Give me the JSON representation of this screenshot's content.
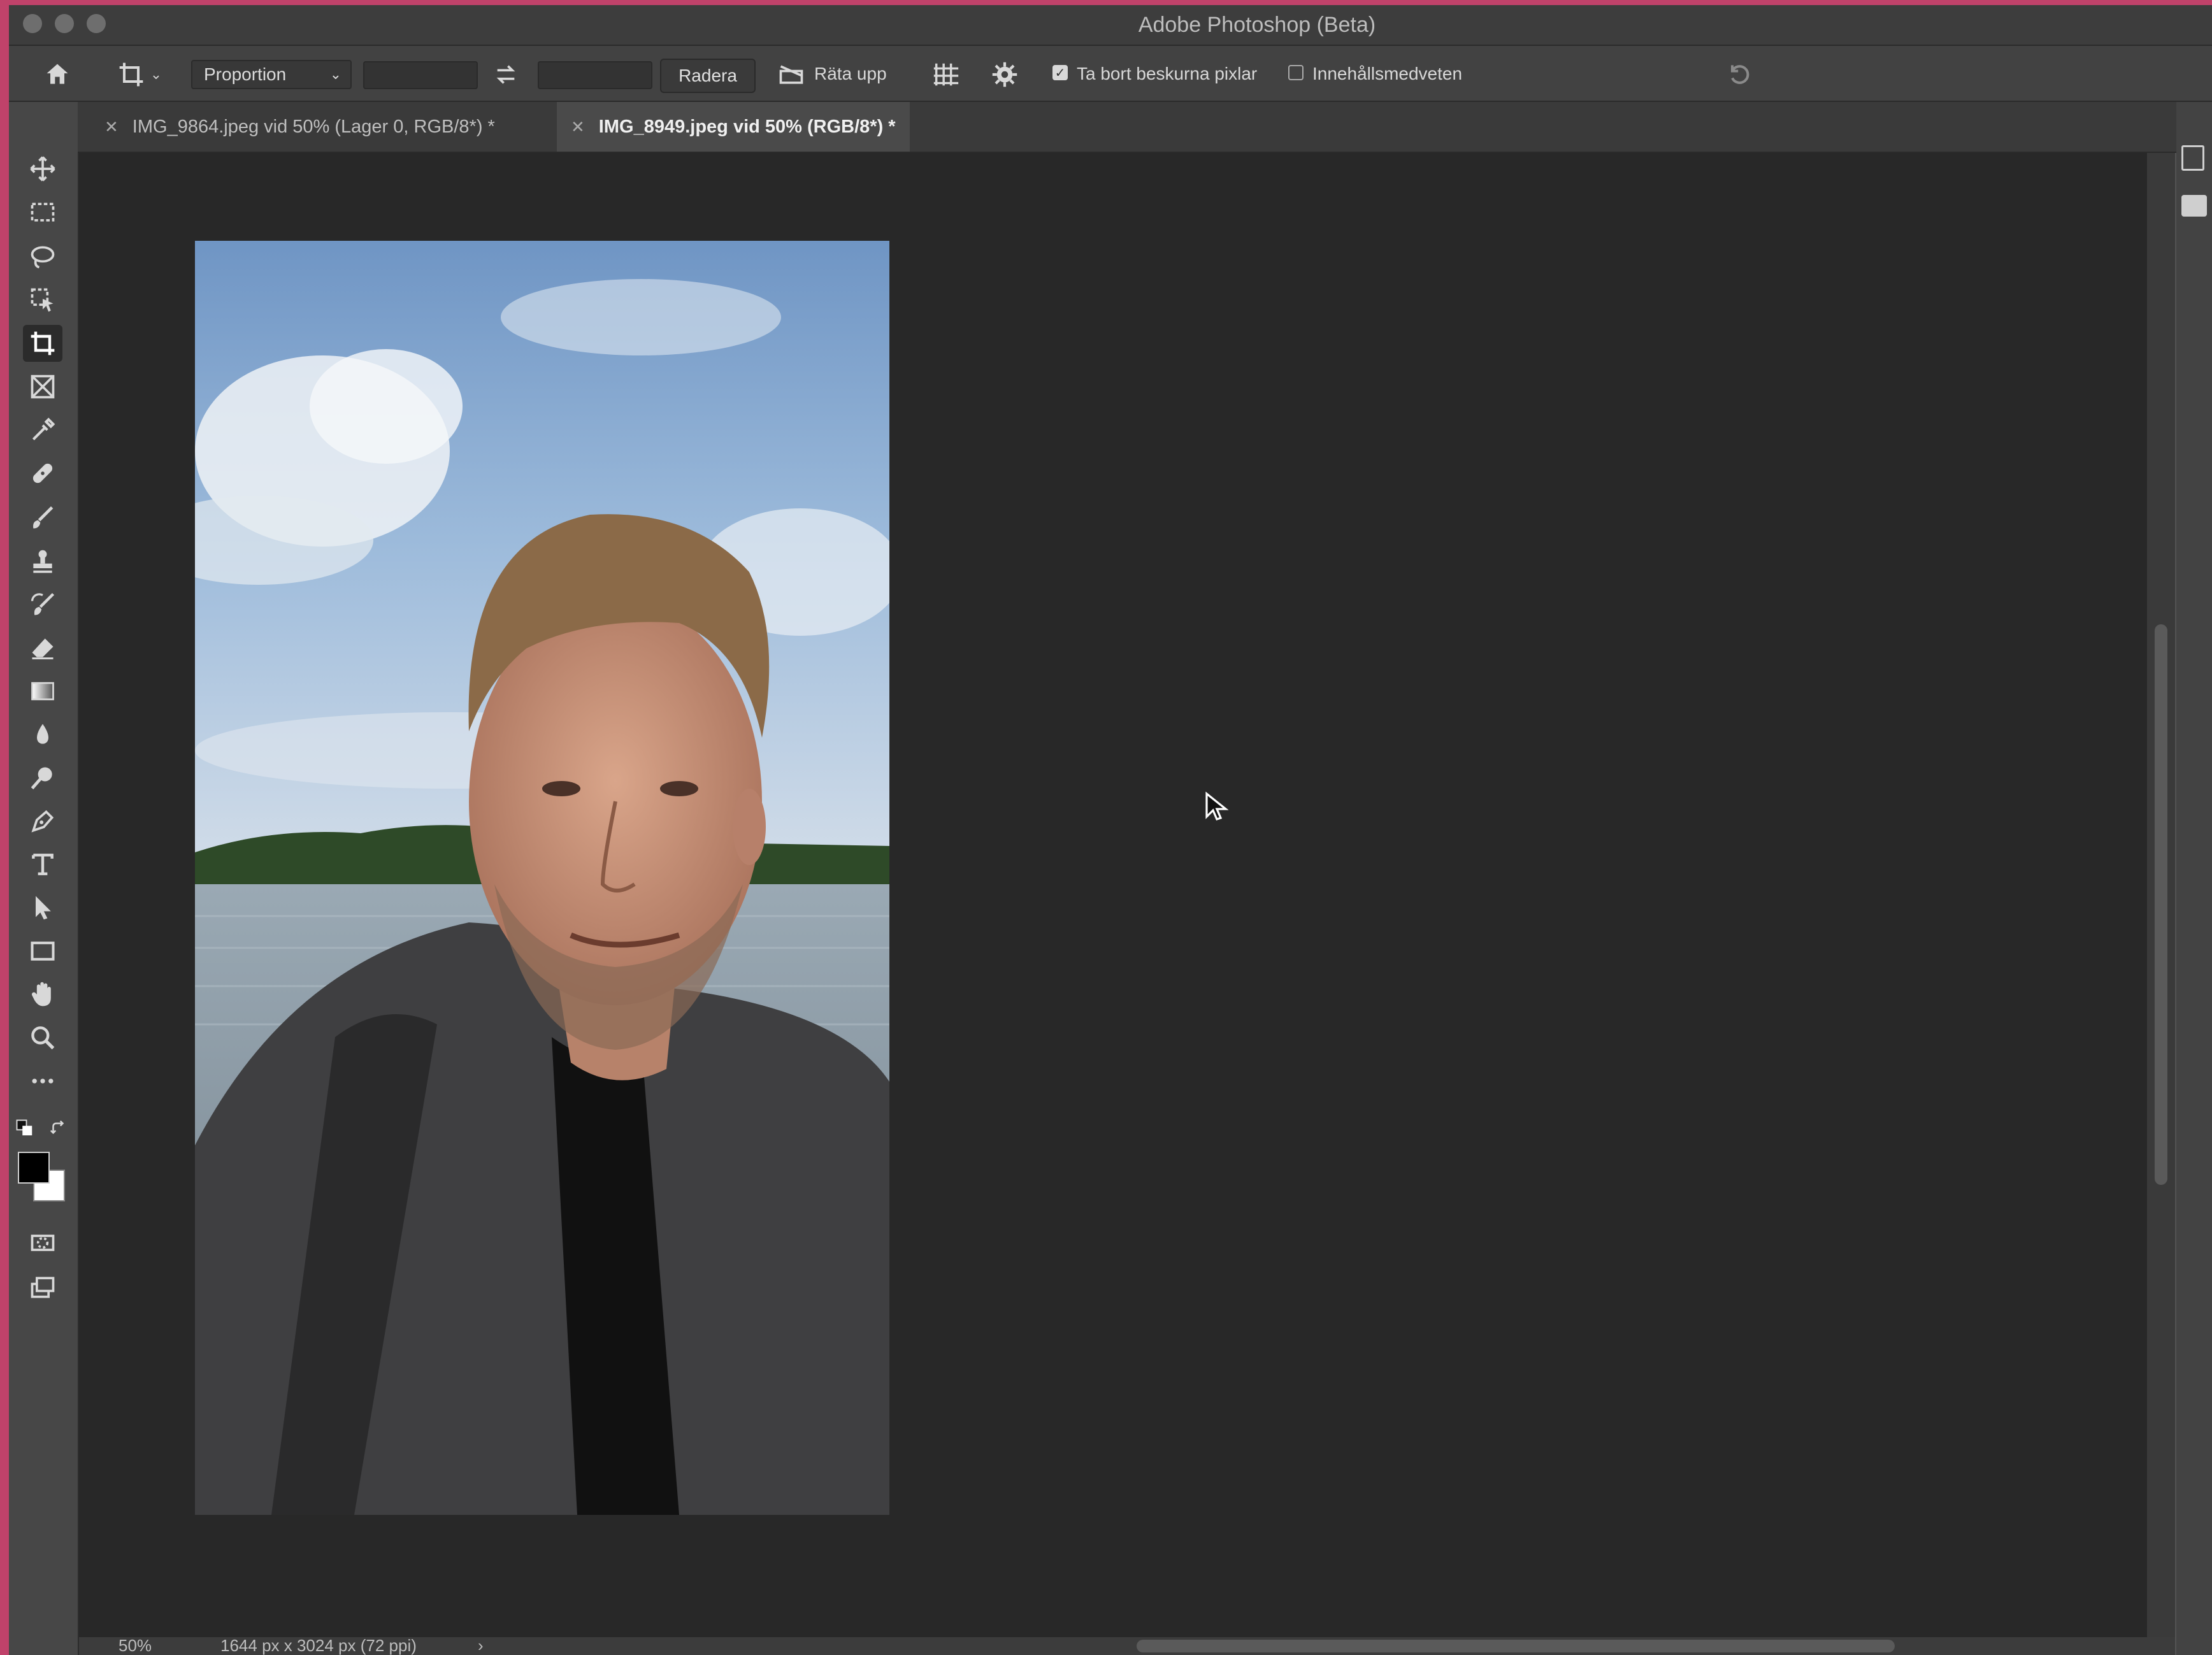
{
  "window": {
    "title": "Adobe Photoshop (Beta)"
  },
  "options_bar": {
    "ratio_dropdown": "Proportion",
    "width_value": "",
    "height_value": "",
    "clear_button": "Radera",
    "straighten_label": "Räta upp",
    "delete_cropped_label": "Ta bort beskurna pixlar",
    "delete_cropped_checked": true,
    "content_aware_label": "Innehållsmedveten",
    "content_aware_checked": false
  },
  "tabs": [
    {
      "label": "IMG_9864.jpeg vid 50% (Lager 0, RGB/8*) *",
      "active": false
    },
    {
      "label": "IMG_8949.jpeg vid 50% (RGB/8*) *",
      "active": true
    }
  ],
  "tools": [
    "move-icon",
    "marquee-icon",
    "lasso-icon",
    "object-select-icon",
    "crop-icon",
    "frame-icon",
    "eyedropper-icon",
    "healing-icon",
    "brush-icon",
    "stamp-icon",
    "history-brush-icon",
    "eraser-icon",
    "gradient-icon",
    "blur-icon",
    "dodge-icon",
    "pen-icon",
    "type-icon",
    "path-select-icon",
    "rectangle-icon",
    "hand-icon",
    "zoom-icon",
    "more-icon"
  ],
  "colors": {
    "foreground": "#000000",
    "background": "#ffffff",
    "accent": "#c0426a"
  },
  "status": {
    "zoom": "50%",
    "doc_info": "1644 px x 3024 px (72 ppi)"
  }
}
